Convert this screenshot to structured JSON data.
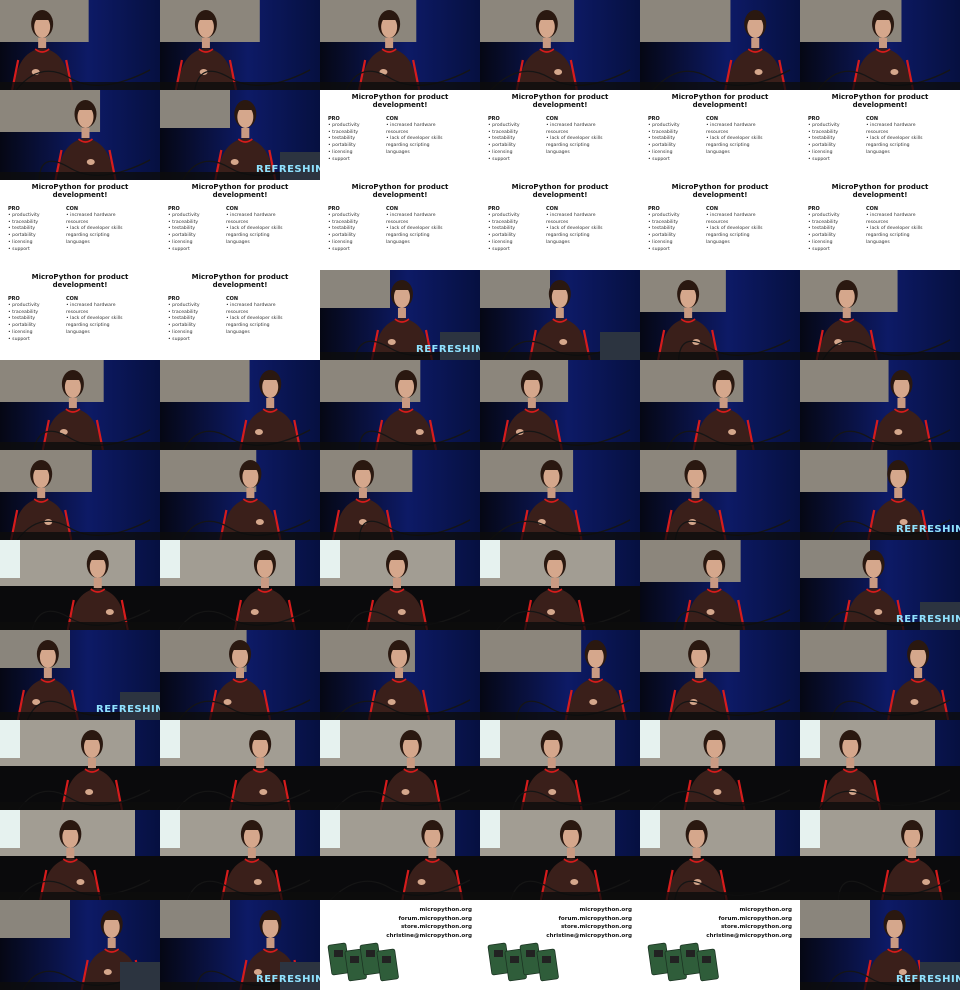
{
  "brand_text": "REFRESHING",
  "slide_pros_cons": {
    "title_line1": "MicroPython for product",
    "title_line2": "development!",
    "pro_heading": "PRO",
    "pro_items": [
      "• productivity",
      "• traceability",
      "• testability",
      "• portability",
      "• licensing",
      "• support"
    ],
    "con_heading": "CON",
    "con_items": [
      "• increased hardware",
      "  resources",
      "• lack of developer skills",
      "  regarding scripting",
      "  languages"
    ]
  },
  "slide_contact": {
    "lines": [
      "micropython.org",
      "forum.micropython.org",
      "store.micropython.org",
      "christine@micropython.org"
    ]
  },
  "cells": [
    "speaker-wall",
    "speaker-wall",
    "speaker-wall",
    "speaker-wall",
    "speaker-wall",
    "speaker-wall",
    "speaker-wall",
    "speaker-podium",
    "slide",
    "slide",
    "slide",
    "slide",
    "slide",
    "slide",
    "slide",
    "slide",
    "slide",
    "slide",
    "slide",
    "slide",
    "speaker-podium",
    "speaker-podium",
    "speaker-wall",
    "speaker-wall",
    "speaker-wall",
    "speaker-wall",
    "speaker-wall",
    "speaker-wall",
    "speaker-wall",
    "speaker-wall",
    "speaker-wall",
    "speaker-wall",
    "speaker-wall",
    "speaker-wall",
    "speaker-wall",
    "speaker-wall",
    "speaker-screen",
    "speaker-screen",
    "speaker-screen",
    "speaker-screen",
    "speaker-wall",
    "speaker-podium",
    "speaker-podium",
    "speaker-wall",
    "speaker-wall",
    "speaker-wall",
    "speaker-wall",
    "speaker-wall",
    "speaker-screen",
    "speaker-screen",
    "speaker-screen",
    "speaker-screen",
    "speaker-screen",
    "speaker-screen",
    "speaker-screen",
    "speaker-screen",
    "speaker-screen",
    "speaker-screen",
    "speaker-screen",
    "speaker-screen",
    "speaker-podium",
    "speaker-podium",
    "contact",
    "contact",
    "contact",
    "speaker-podium"
  ],
  "brand_cells": [
    7,
    20,
    35,
    41,
    42,
    61,
    65
  ]
}
